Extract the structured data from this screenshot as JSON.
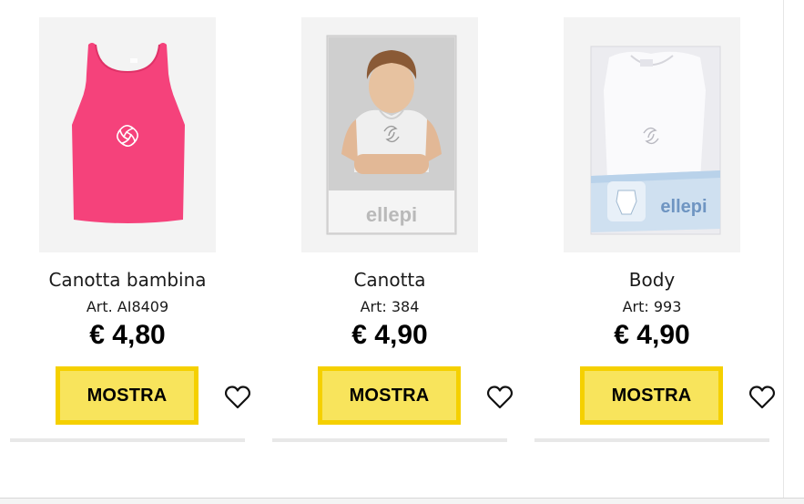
{
  "products": [
    {
      "name": "Canotta bambina",
      "art": "Art. AI8409",
      "price": "€ 4,80",
      "button": "MOSTRA",
      "image_icon": "pink-tank-top-image",
      "wishlist_icon": "heart-icon"
    },
    {
      "name": "Canotta",
      "art": "Art: 384",
      "price": "€ 4,90",
      "button": "MOSTRA",
      "image_icon": "boy-undershirt-package-image",
      "wishlist_icon": "heart-icon"
    },
    {
      "name": "Body",
      "art": "Art: 993",
      "price": "€ 4,90",
      "button": "MOSTRA",
      "image_icon": "white-body-package-image",
      "wishlist_icon": "heart-icon"
    }
  ],
  "brand": {
    "package_logo": "ellepi"
  },
  "colors": {
    "button_fill": "#f8e45c",
    "button_border": "#f5d000",
    "tank_pink": "#f5427b"
  }
}
